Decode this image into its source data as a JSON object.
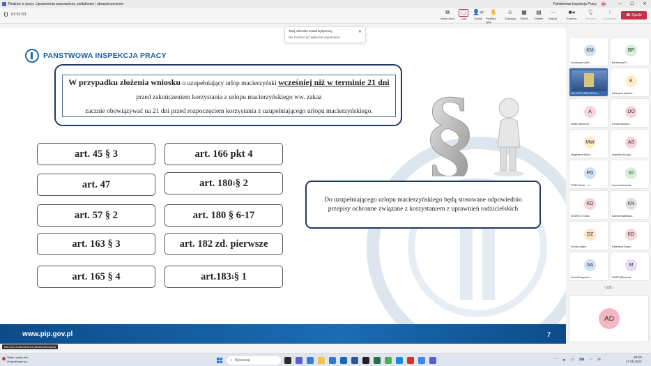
{
  "window": {
    "title": "Rodzice w pracy. Uprawnienia pracownicze, podatkowe i ubezpieczeniowe",
    "org": "Państwowa Inspekcja Pracy",
    "user_initials": "AD"
  },
  "toolbar": {
    "timer": "01:51:53",
    "items": [
      {
        "label": "Nowe okno",
        "icon": "new-window-icon"
      },
      {
        "label": "Czat",
        "icon": "chat-icon"
      },
      {
        "label": "Osoby",
        "count": "47",
        "icon": "people-icon"
      },
      {
        "label": "Podnieś rękę",
        "icon": "raise-hand-icon"
      },
      {
        "label": "Zareaguj",
        "icon": "react-icon"
      },
      {
        "label": "Widok",
        "icon": "view-icon"
      },
      {
        "label": "Notatki",
        "icon": "notes-icon"
      },
      {
        "label": "Więcej",
        "icon": "more-icon"
      },
      {
        "label": "Kamera",
        "icon": "camera-icon"
      },
      {
        "label": "Mikrofon",
        "icon": "mic-icon"
      },
      {
        "label": "Udostępnij",
        "icon": "share-icon"
      }
    ],
    "leave_label": "Opuść",
    "accent": "#c4314b"
  },
  "toast": {
    "title": "Twój mikrofon został wyłączony",
    "body": "Nie możesz już wyłączać wyciszenia."
  },
  "slide": {
    "logo": "PAŃSTWOWA INSPEKCJA PRACY",
    "top_text": {
      "bold1": "W przypadku złożenia wniosku",
      "normal1": " o uzupełniający urlop macierzyński ",
      "bold2": "wcześniej niż w terminie 21 dni",
      "line2": "przed zakończeniem korzystania z urlopu macierzyńskiego ww. zakaz",
      "line3": "zacznie obowiązywać na 21 dni przed rozpoczęciem korzystania z uzupełniającego urlopu macierzyńskiego."
    },
    "articles_left": [
      "art. 45 § 3",
      "art. 47",
      "art. 57 § 2",
      "art. 163 § 3",
      "art. 165 § 4"
    ],
    "articles_right": [
      {
        "pre": "art. 166 pkt 4",
        "sup": "",
        "post": ""
      },
      {
        "pre": "art. 180",
        "sup": "1",
        "post": " § 2"
      },
      {
        "pre": "art. 180 § 6-17",
        "sup": "",
        "post": ""
      },
      {
        "pre": "art. 182 zd. pierwsze",
        "sup": "",
        "post": ""
      },
      {
        "pre": "art.183",
        "sup": "1",
        "post": " § 1"
      }
    ],
    "info_text": "Do uzupełniającego urlopu macierzyńskiego będą stosowane odpowiednio przepisy ochronne związane z korzystaniem z uprawnień rodzicielskich",
    "footer_url": "www.pip.gov.pl",
    "page_number": "7",
    "brand_color": "#1f3864"
  },
  "sharer_label": "IAS-OLS-LUBLSKA-A1 (Nieweryfikowani)",
  "participants": [
    {
      "initials": "KM",
      "name": "Kowalczyk Milen...",
      "color": "#cfe0f3"
    },
    {
      "initials": "BP",
      "name": "Bartkowiaj Pi...",
      "color": "#d7ecd9"
    },
    {
      "initials": "",
      "name": "IAS-OLS-LUBELSKA-A...",
      "color": "#3a6db0",
      "video": true
    },
    {
      "initials": "K",
      "name": "Katarzyna (Nieww...",
      "color": "#fbefc6"
    },
    {
      "initials": "A",
      "name": "aNNA (Nieweryf...",
      "color": "#f7d3da"
    },
    {
      "initials": "DO",
      "name": "Dorota Okoubo...",
      "color": "#f7d3da"
    },
    {
      "initials": "MW",
      "name": "Magdalena Wasa...",
      "color": "#fbefc6"
    },
    {
      "initials": "AS",
      "name": "Angelika Szczyg...",
      "color": "#f7d3da"
    },
    {
      "initials": "PG",
      "name": "PSSE Golub... -L...",
      "color": "#cfe0f3"
    },
    {
      "initials": "ID",
      "name": "Iwona Dobkowsk...",
      "color": "#d7ecd9"
    },
    {
      "initials": "KO",
      "name": "KOWR OT Olszt...",
      "color": "#f7d3da"
    },
    {
      "initials": "KN",
      "name": "Kamila Nabielska...",
      "color": "#e0e0e0"
    },
    {
      "initials": "DZ",
      "name": "Dorota Zagho...",
      "color": "#fde2c6"
    },
    {
      "initials": "KD",
      "name": "Katarzyna Dryka...",
      "color": "#f7d3da"
    },
    {
      "initials": "SA",
      "name": "Schmidt Agniesz...",
      "color": "#cfe0f3"
    },
    {
      "initials": "M",
      "name": "MOPS (Nieweryf...",
      "color": "#e4dcf3"
    }
  ],
  "pager": "1/3",
  "self_tile": {
    "initials": "AD"
  },
  "taskbar": {
    "weather_line1": "Słabe opady des...",
    "weather_line2": "W godzinach po...",
    "search_placeholder": "Wyszukaj",
    "time": "20:20",
    "date": "27.06.2023"
  }
}
